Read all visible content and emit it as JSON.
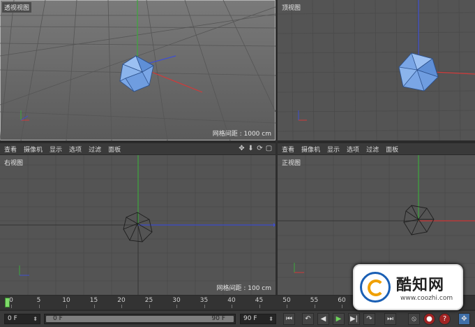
{
  "viewports": {
    "perspective": {
      "label": "透视视图",
      "grid_spacing": "网格间距 : 1000 cm"
    },
    "top": {
      "label": "顶视图"
    },
    "right": {
      "label": "右视图",
      "grid_spacing": "网格间距 : 100 cm"
    },
    "front": {
      "label": "正视图"
    }
  },
  "menu": [
    "查看",
    "摄像机",
    "显示",
    "选项",
    "过滤",
    "面板"
  ],
  "axes": {
    "x": "X",
    "y": "Y",
    "z": "Z"
  },
  "timeline": {
    "ticks": [
      "0",
      "5",
      "10",
      "15",
      "20",
      "25",
      "30",
      "35",
      "40",
      "45",
      "50",
      "55",
      "60"
    ]
  },
  "controls": {
    "start_frame": "0 F",
    "slider_start": "0 F",
    "slider_end": "90 F",
    "end_frame": "90 F"
  },
  "watermark": {
    "brand": "酷知网",
    "url": "www.coozhi.com"
  },
  "icons": [
    "move-icon",
    "down-arrow-icon",
    "rotate-icon",
    "maximize-icon",
    "goto-start-icon",
    "prev-key-icon",
    "play-back-icon",
    "play-icon",
    "next-key-icon",
    "goto-end-icon",
    "loop-icon",
    "record-icon",
    "autokey-icon",
    "keyframe-icon"
  ],
  "colors": {
    "accent_play": "#6ed35b",
    "axis_x": "#d03a3a",
    "axis_y": "#3ca83c",
    "axis_z": "#3f4fd0",
    "object_blue": "#6f9de0"
  }
}
